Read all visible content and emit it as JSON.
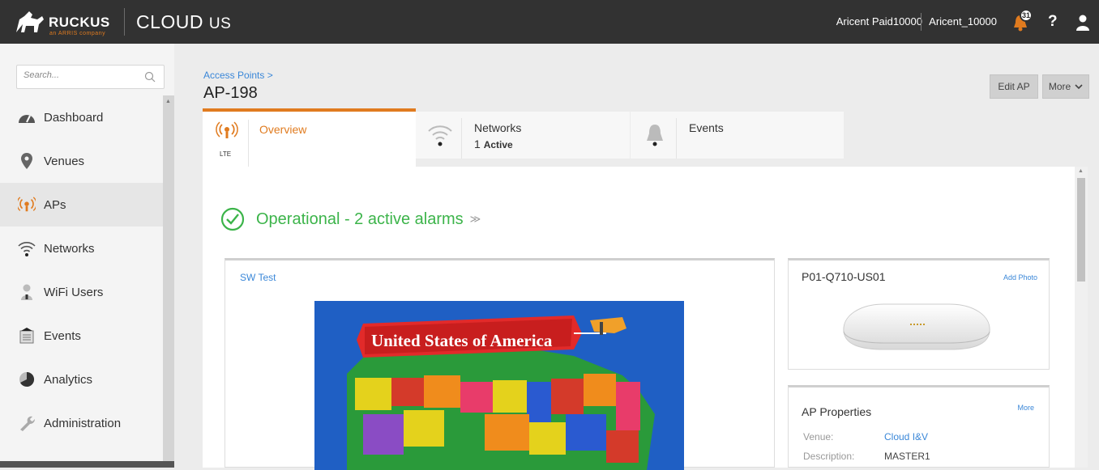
{
  "header": {
    "brand": "RUCKUS",
    "brand_sub": "an ARRIS company",
    "product": "CLOUD",
    "region": "US",
    "account_name": "Aricent Paid10000",
    "account_id": "Aricent_10000",
    "notification_count": "31",
    "help_label": "?",
    "icons": [
      "ruckus-logo",
      "bell-icon",
      "help-icon",
      "user-icon"
    ]
  },
  "sidebar": {
    "search_placeholder": "Search...",
    "items": [
      {
        "label": "Dashboard",
        "icon": "gauge-icon"
      },
      {
        "label": "Venues",
        "icon": "map-pin-icon"
      },
      {
        "label": "APs",
        "icon": "ap-radio-icon",
        "active": true
      },
      {
        "label": "Networks",
        "icon": "wifi-icon"
      },
      {
        "label": "WiFi Users",
        "icon": "user-icon"
      },
      {
        "label": "Events",
        "icon": "events-icon"
      },
      {
        "label": "Analytics",
        "icon": "pie-chart-icon"
      },
      {
        "label": "Administration",
        "icon": "wrench-icon"
      }
    ]
  },
  "main": {
    "breadcrumb": "Access Points >",
    "title": "AP-198",
    "edit_button": "Edit AP",
    "more_button": "More",
    "tabs": [
      {
        "label": "Overview",
        "sub": "",
        "badge": "LTE"
      },
      {
        "label": "Networks",
        "count": "1",
        "sub": "Active"
      },
      {
        "label": "Events",
        "sub": ""
      }
    ],
    "status": "Operational - 2 active alarms",
    "map_card": {
      "caption": "SW Test",
      "banner": "United States of America"
    },
    "ap_card": {
      "model": "P01-Q710-US01",
      "add_photo": "Add Photo"
    },
    "properties": {
      "heading": "AP Properties",
      "more": "More",
      "rows": [
        {
          "label": "Venue:",
          "value": "Cloud I&V"
        },
        {
          "label": "Description:",
          "value": "MASTER1"
        }
      ]
    }
  },
  "colors": {
    "accent": "#e07b1f",
    "link": "#3a87d8",
    "success": "#3cb44a",
    "topbar": "#323232"
  }
}
